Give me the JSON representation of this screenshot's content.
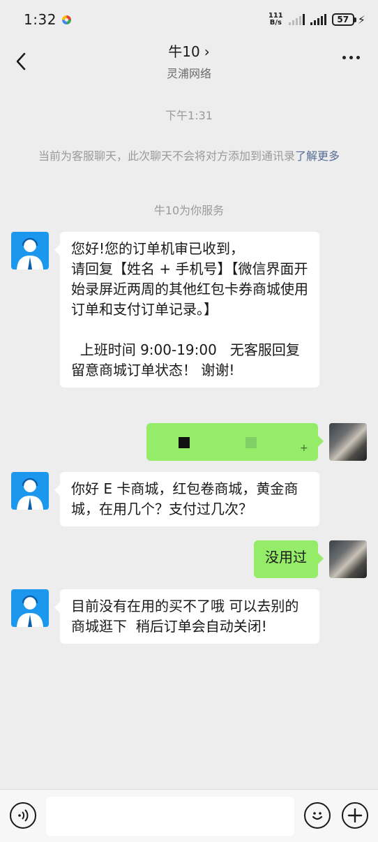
{
  "status_bar": {
    "time": "1:32",
    "net_speed_value": "111",
    "net_speed_unit": "B/s",
    "battery": "57"
  },
  "header": {
    "title": "牛10",
    "subtitle": "灵浦网络"
  },
  "system": {
    "time_label": "下午1:31",
    "notice_text": "当前为客服聊天，此次聊天不会将对方添加到通讯录",
    "notice_link": "了解更多",
    "service_text": "牛10为你服务"
  },
  "messages": [
    {
      "from": "agent",
      "text": "您好!您的订单机审已收到，\n请回复【姓名 + 手机号】【微信界面开始录屏近两周的其他红包卡券商城使用订单和支付订单记录。】\n\n  上班时间 9:00-19:00   无客服回复 留意商城订单状态！ 谢谢!"
    },
    {
      "from": "me",
      "text": ""
    },
    {
      "from": "agent",
      "text": "你好 E 卡商城，红包卷商城，黄金商城，在用几个？支付过几次？"
    },
    {
      "from": "me",
      "text": "没用过"
    },
    {
      "from": "agent",
      "text": "目前没有在用的买不了哦 可以去别的商城逛下  稍后订单会自动关闭!"
    }
  ],
  "icons": {
    "back": "chevron-left-icon",
    "more": "more-dots-icon",
    "voice": "voice-icon",
    "emoji": "emoji-icon",
    "plus": "plus-icon"
  },
  "colors": {
    "background": "#ededed",
    "my_bubble": "#95ec69",
    "agent_bubble": "#ffffff",
    "agent_avatar": "#1c97ee",
    "link": "#576b95"
  }
}
